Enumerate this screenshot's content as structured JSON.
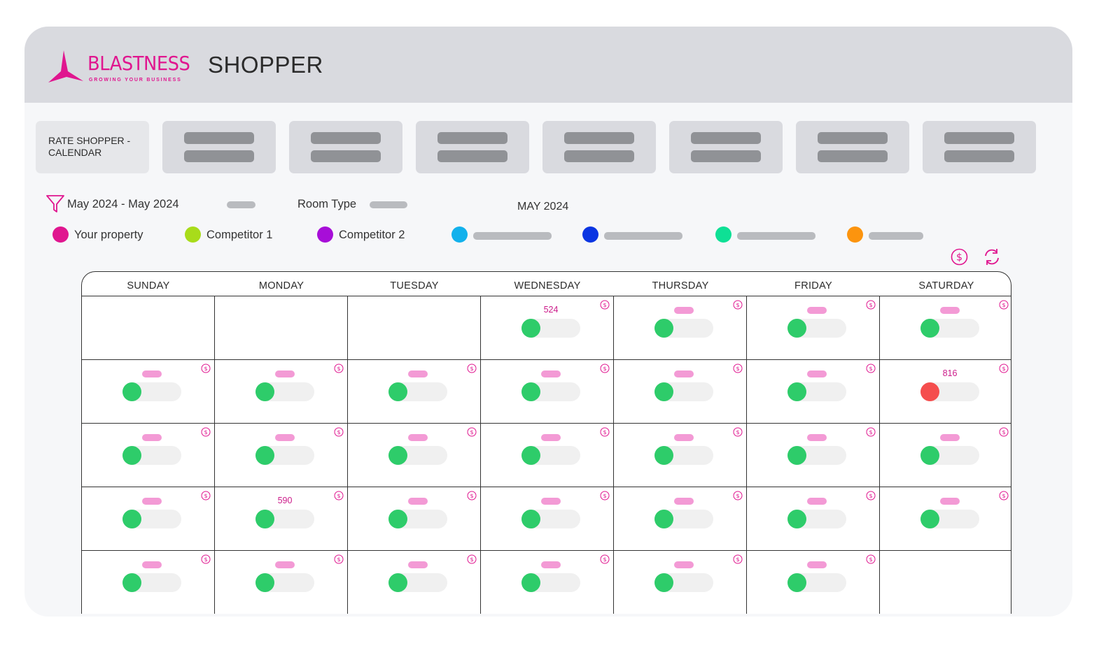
{
  "brand": {
    "logo_name": "BLASTNESS",
    "logo_tagline": "GROWING YOUR BUSINESS",
    "app_title": "SHOPPER",
    "accent": "#e0168f"
  },
  "tabs": {
    "first_label": "RATE SHOPPER - CALENDAR",
    "placeholder_count": 7
  },
  "filters": {
    "date_range": "May 2024 - May 2024",
    "room_type_label": "Room Type",
    "month_label": "MAY 2024"
  },
  "legend": [
    {
      "label": "Your property",
      "color": "#e0168f"
    },
    {
      "label": "Competitor 1",
      "color": "#a8dc1a"
    },
    {
      "label": "Competitor 2",
      "color": "#a70ed8"
    },
    {
      "label": "",
      "color": "#12b1ec"
    },
    {
      "label": "",
      "color": "#0a35e2"
    },
    {
      "label": "",
      "color": "#0ee095"
    },
    {
      "label": "",
      "color": "#fc940e"
    }
  ],
  "toolbar": {
    "currency_icon": "dollar-circle-icon",
    "refresh_icon": "refresh-icon"
  },
  "calendar": {
    "days": [
      "SUNDAY",
      "MONDAY",
      "TUESDAY",
      "WEDNESDAY",
      "THURSDAY",
      "FRIDAY",
      "SATURDAY"
    ],
    "weeks": [
      [
        null,
        null,
        null,
        {
          "price": "524",
          "status": "green"
        },
        {
          "status": "green"
        },
        {
          "status": "green"
        },
        {
          "status": "green"
        }
      ],
      [
        {
          "status": "green"
        },
        {
          "status": "green"
        },
        {
          "status": "green"
        },
        {
          "status": "green"
        },
        {
          "status": "green"
        },
        {
          "status": "green"
        },
        {
          "price": "816",
          "status": "red"
        }
      ],
      [
        {
          "status": "green"
        },
        {
          "status": "green"
        },
        {
          "status": "green"
        },
        {
          "status": "green"
        },
        {
          "status": "green"
        },
        {
          "status": "green"
        },
        {
          "status": "green"
        }
      ],
      [
        {
          "status": "green"
        },
        {
          "price": "590",
          "status": "green"
        },
        {
          "status": "green"
        },
        {
          "status": "green"
        },
        {
          "status": "green"
        },
        {
          "status": "green"
        },
        {
          "status": "green"
        }
      ],
      [
        {
          "status": "green"
        },
        {
          "status": "green"
        },
        {
          "status": "green"
        },
        {
          "status": "green"
        },
        {
          "status": "green"
        },
        {
          "status": "green"
        },
        null
      ]
    ],
    "status_colors": {
      "green": "#2ecc6a",
      "red": "#f54e4e"
    }
  }
}
